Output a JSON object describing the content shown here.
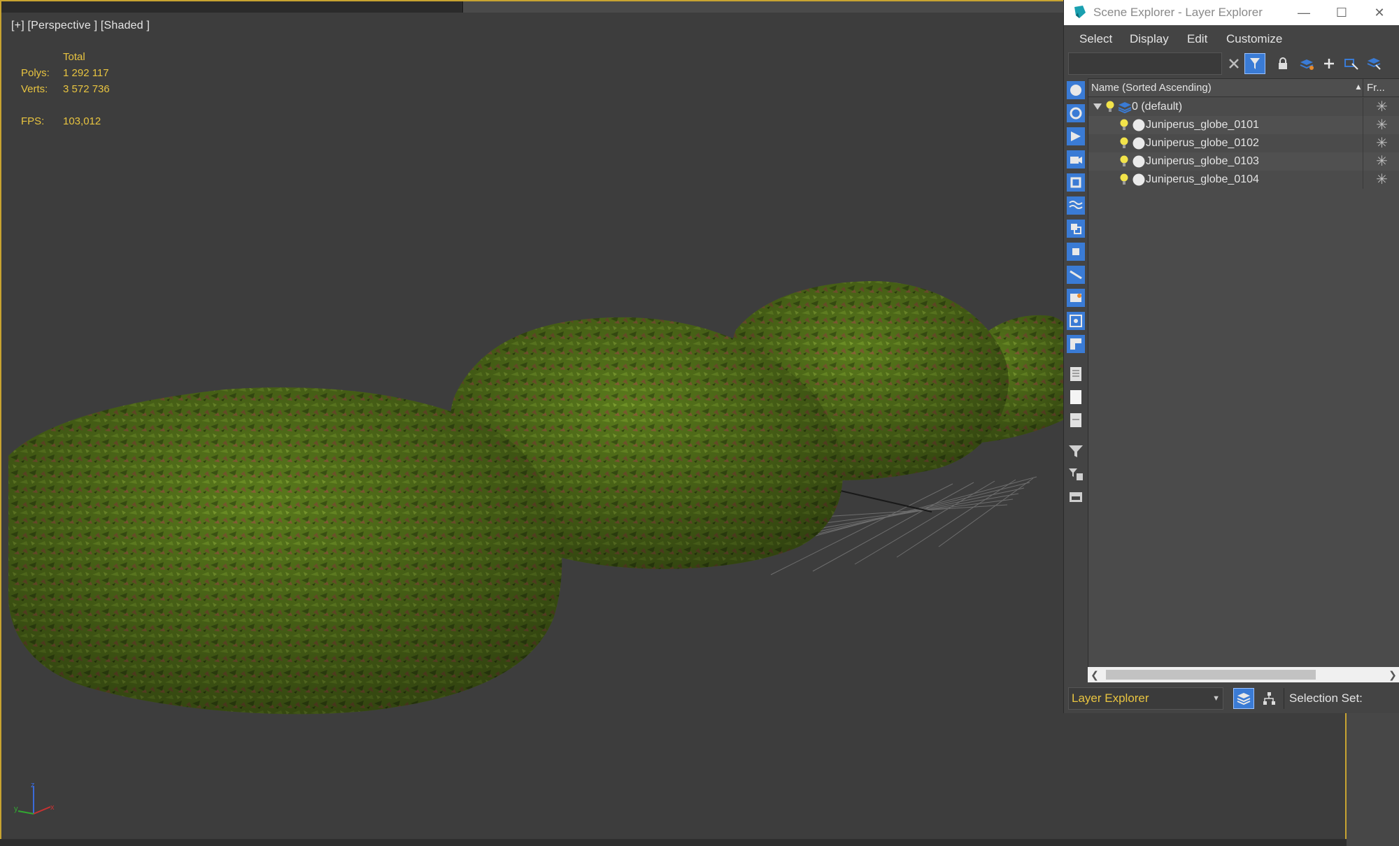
{
  "viewport": {
    "label": "[+] [Perspective ] [Shaded ]",
    "stats": {
      "header": "Total",
      "polys_label": "Polys:",
      "polys_value": "1 292 117",
      "verts_label": "Verts:",
      "verts_value": "3 572 736",
      "fps_label": "FPS:",
      "fps_value": "103,012"
    },
    "gizmo_axes": [
      "x",
      "y",
      "z"
    ]
  },
  "explorer": {
    "title": "Scene Explorer - Layer Explorer",
    "window_buttons": {
      "minimize": "—",
      "maximize": "☐",
      "close": "✕"
    },
    "menu": [
      "Select",
      "Display",
      "Edit",
      "Customize"
    ],
    "column_header": {
      "name": "Name (Sorted Ascending)",
      "sort_glyph": "▲",
      "freeze": "Fr..."
    },
    "tree": [
      {
        "label": "0 (default)",
        "type": "layer",
        "expanded": true
      },
      {
        "label": "Juniperus_globe_0101",
        "type": "object"
      },
      {
        "label": "Juniperus_globe_0102",
        "type": "object"
      },
      {
        "label": "Juniperus_globe_0103",
        "type": "object"
      },
      {
        "label": "Juniperus_globe_0104",
        "type": "object"
      }
    ],
    "freeze_glyph": "✳",
    "bottom": {
      "explorer_mode": "Layer Explorer",
      "selection_set_label": "Selection Set:"
    }
  },
  "colors": {
    "accent_yellow": "#e8c440",
    "viewport_bg": "#3d3d3d",
    "panel_bg": "#444444",
    "icon_blue": "#3a7bd5"
  }
}
